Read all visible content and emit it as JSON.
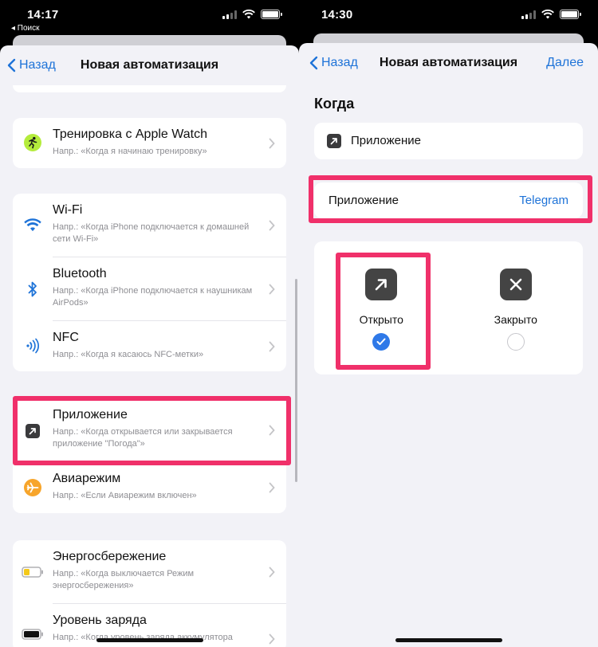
{
  "left": {
    "status": {
      "time": "14:17",
      "back_app": "◂ Поиск"
    },
    "nav": {
      "back_label": "Назад",
      "title": "Новая автоматизация"
    },
    "items": [
      {
        "name": "Тренировка с Apple Watch",
        "desc": "Напр.: «Когда я начинаю тренировку»",
        "icon": "running-icon"
      },
      {
        "name": "Wi-Fi",
        "desc": "Напр.: «Когда iPhone подключается к домашней сети Wi-Fi»",
        "icon": "wifi-icon"
      },
      {
        "name": "Bluetooth",
        "desc": "Напр.: «Когда iPhone подключается к наушникам AirPods»",
        "icon": "bluetooth-icon"
      },
      {
        "name": "NFC",
        "desc": "Напр.: «Когда я касаюсь NFC-метки»",
        "icon": "nfc-icon"
      },
      {
        "name": "Приложение",
        "desc": "Напр.: «Когда открывается или закрывается приложение \"Погода\"»",
        "icon": "app-arrow-icon"
      },
      {
        "name": "Авиарежим",
        "desc": "Напр.: «Если Авиарежим включен»",
        "icon": "airplane-icon"
      },
      {
        "name": "Энергосбережение",
        "desc": "Напр.: «Когда выключается Режим энергосбережения»",
        "icon": "low-battery-icon"
      },
      {
        "name": "Уровень заряда",
        "desc": "Напр.: «Когда уровень заряда аккумулятора",
        "icon": "battery-icon"
      }
    ]
  },
  "right": {
    "status": {
      "time": "14:30"
    },
    "nav": {
      "back_label": "Назад",
      "title": "Новая автоматизация",
      "next_label": "Далее"
    },
    "section_title": "Когда",
    "trigger_label": "Приложение",
    "app_row": {
      "label": "Приложение",
      "value": "Telegram"
    },
    "options": [
      {
        "label": "Открыто",
        "selected": true,
        "icon": "open-arrow-icon"
      },
      {
        "label": "Закрыто",
        "selected": false,
        "icon": "close-x-icon"
      }
    ]
  },
  "colors": {
    "accent": "#1e73d8",
    "highlight": "#f0306a",
    "check": "#2f79e8"
  }
}
